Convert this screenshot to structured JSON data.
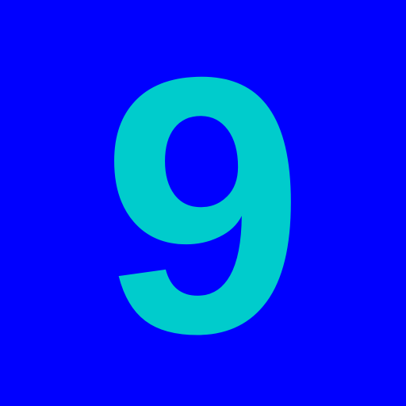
{
  "tile": {
    "digit": "9",
    "background_color": "#0000ff",
    "digit_color": "#00cccc"
  }
}
